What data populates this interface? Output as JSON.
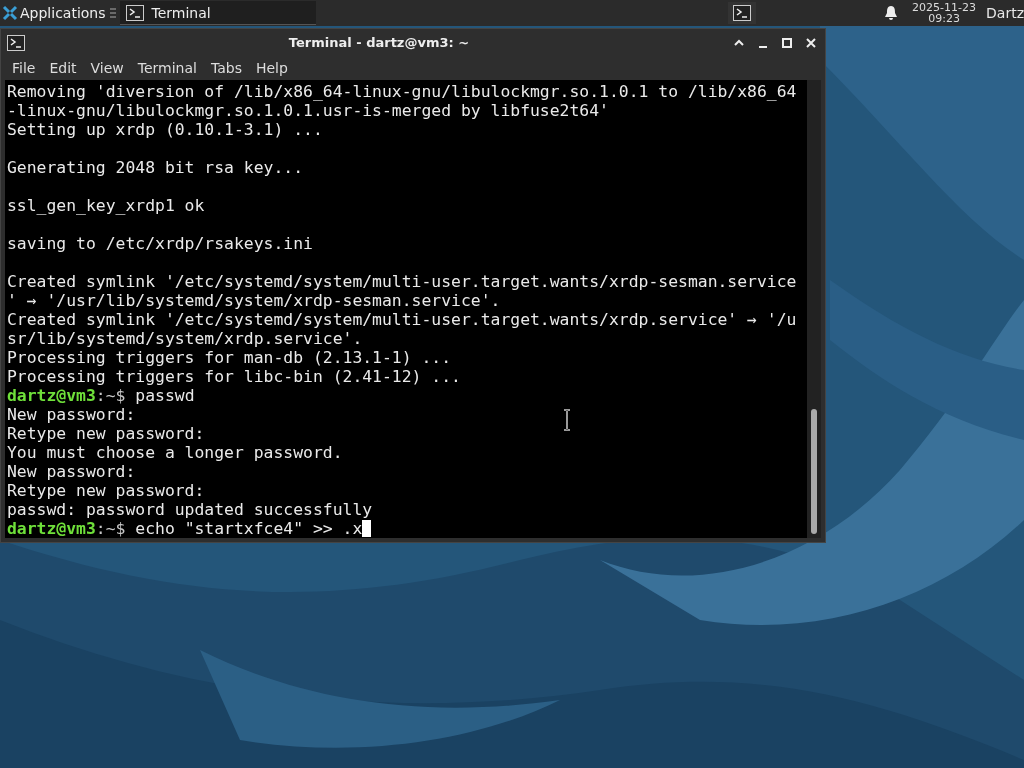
{
  "panel": {
    "applications_label": "Applications",
    "tasks": [
      {
        "label": "Terminal",
        "selected": true
      }
    ],
    "clock": {
      "date": "2025-11-23",
      "time": "09:23"
    },
    "user": "Dartz"
  },
  "window": {
    "title": "Terminal - dartz@vm3: ~",
    "menu": [
      "File",
      "Edit",
      "View",
      "Terminal",
      "Tabs",
      "Help"
    ],
    "lines": [
      {
        "kind": "output",
        "text": "Removing 'diversion of /lib/x86_64-linux-gnu/libulockmgr.so.1.0.1 to /lib/x86_64"
      },
      {
        "kind": "output",
        "text": "-linux-gnu/libulockmgr.so.1.0.1.usr-is-merged by libfuse2t64'"
      },
      {
        "kind": "output",
        "text": "Setting up xrdp (0.10.1-3.1) ..."
      },
      {
        "kind": "blank"
      },
      {
        "kind": "output",
        "text": "Generating 2048 bit rsa key..."
      },
      {
        "kind": "blank"
      },
      {
        "kind": "output",
        "text": "ssl_gen_key_xrdp1 ok"
      },
      {
        "kind": "blank"
      },
      {
        "kind": "output",
        "text": "saving to /etc/xrdp/rsakeys.ini"
      },
      {
        "kind": "blank"
      },
      {
        "kind": "output",
        "text": "Created symlink '/etc/systemd/system/multi-user.target.wants/xrdp-sesman.service"
      },
      {
        "kind": "output",
        "text": "' → '/usr/lib/systemd/system/xrdp-sesman.service'."
      },
      {
        "kind": "output",
        "text": "Created symlink '/etc/systemd/system/multi-user.target.wants/xrdp.service' → '/u"
      },
      {
        "kind": "output",
        "text": "sr/lib/systemd/system/xrdp.service'."
      },
      {
        "kind": "output",
        "text": "Processing triggers for man-db (2.13.1-1) ..."
      },
      {
        "kind": "output",
        "text": "Processing triggers for libc-bin (2.41-12) ..."
      },
      {
        "kind": "prompt",
        "user": "dartz@vm3",
        "path": ":~$",
        "command": "passwd",
        "cursor": false
      },
      {
        "kind": "output",
        "text": "New password:"
      },
      {
        "kind": "output",
        "text": "Retype new password:"
      },
      {
        "kind": "output",
        "text": "You must choose a longer password."
      },
      {
        "kind": "output",
        "text": "New password:"
      },
      {
        "kind": "output",
        "text": "Retype new password:"
      },
      {
        "kind": "output",
        "text": "passwd: password updated successfully"
      },
      {
        "kind": "prompt",
        "user": "dartz@vm3",
        "path": ":~$",
        "command": "echo \"startxfce4\" >> .x",
        "cursor": true
      }
    ]
  }
}
